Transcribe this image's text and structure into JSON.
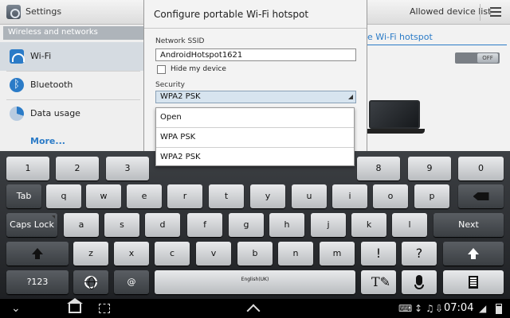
{
  "app": {
    "title": "Settings"
  },
  "actionbar": {
    "allowed_devices": "Allowed device list",
    "menu_icon": "menu-icon"
  },
  "sidebar": {
    "section": "Wireless and networks",
    "items": [
      {
        "label": "Wi-Fi",
        "icon": "wifi-icon"
      },
      {
        "label": "Bluetooth",
        "icon": "bluetooth-icon"
      },
      {
        "label": "Data usage",
        "icon": "data-usage-icon"
      }
    ],
    "more": "More..."
  },
  "detail": {
    "title_fragment": "ble Wi-Fi hotspot",
    "toggle_state": "OFF"
  },
  "dialog": {
    "title": "Configure portable Wi-Fi hotspot",
    "ssid_label": "Network SSID",
    "ssid_value": "AndroidHotspot1621",
    "hide_label": "Hide my device",
    "hide_checked": false,
    "security_label": "Security",
    "security_value": "WPA2 PSK",
    "security_options": [
      "Open",
      "WPA PSK",
      "WPA2 PSK"
    ]
  },
  "keyboard": {
    "row1": [
      "1",
      "2",
      "3",
      "4",
      "5",
      "6",
      "7",
      "8",
      "9",
      "0"
    ],
    "row2": [
      "Tab",
      "q",
      "w",
      "e",
      "r",
      "t",
      "y",
      "u",
      "i",
      "o",
      "p"
    ],
    "row3": [
      "Caps Lock",
      "a",
      "s",
      "d",
      "f",
      "g",
      "h",
      "j",
      "k",
      "l",
      "Next"
    ],
    "row4": [
      "z",
      "x",
      "c",
      "v",
      "b",
      "n",
      "m",
      "!",
      "?"
    ],
    "row5": {
      "symbols": "?123",
      "at": "@",
      "space": "English(UK)"
    }
  },
  "systembar": {
    "time": "07:04"
  },
  "colors": {
    "accent": "#2b7bc7",
    "keyboard_bg": "#2a2d30",
    "dialog_bg": "#f3f3f3"
  }
}
